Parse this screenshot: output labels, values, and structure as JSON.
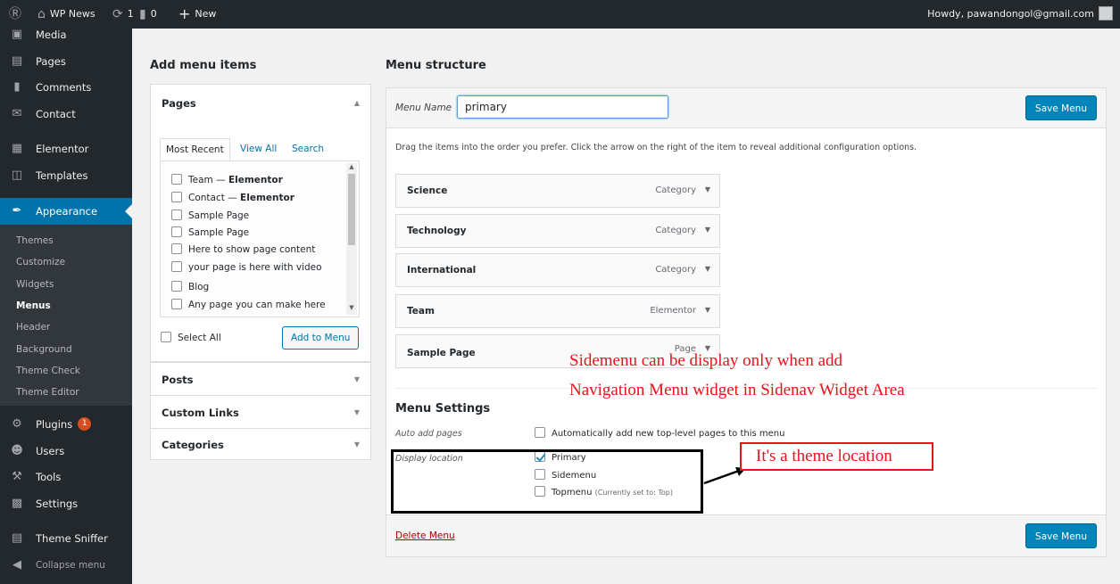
{
  "adminbar": {
    "site_name": "WP News",
    "updates": "1",
    "comments": "0",
    "new_label": "New",
    "howdy": "Howdy, pawandongol@gmail.com"
  },
  "sidebar": {
    "items": [
      {
        "label": "Media",
        "icon": "media-icon"
      },
      {
        "label": "Pages",
        "icon": "pages-icon"
      },
      {
        "label": "Comments",
        "icon": "comments-icon"
      },
      {
        "label": "Contact",
        "icon": "contact-icon"
      },
      {
        "label": "Elementor",
        "icon": "elementor-icon"
      },
      {
        "label": "Templates",
        "icon": "templates-icon"
      },
      {
        "label": "Appearance",
        "icon": "appearance-icon"
      },
      {
        "label": "Plugins",
        "icon": "plugins-icon",
        "badge": "1"
      },
      {
        "label": "Users",
        "icon": "users-icon"
      },
      {
        "label": "Tools",
        "icon": "tools-icon"
      },
      {
        "label": "Settings",
        "icon": "settings-icon"
      },
      {
        "label": "Theme Sniffer",
        "icon": "theme-sniffer-icon"
      },
      {
        "label": "Collapse menu",
        "icon": "collapse-icon"
      }
    ],
    "submenu": [
      "Themes",
      "Customize",
      "Widgets",
      "Menus",
      "Header",
      "Background",
      "Theme Check",
      "Theme Editor"
    ],
    "current_submenu": "Menus"
  },
  "add_items": {
    "heading": "Add menu items",
    "pages_title": "Pages",
    "tabs": [
      "Most Recent",
      "View All",
      "Search"
    ],
    "pages": [
      {
        "label": "Team",
        "suffix": "Elementor"
      },
      {
        "label": "Contact",
        "suffix": "Elementor"
      },
      {
        "label": "Sample Page",
        "suffix": ""
      },
      {
        "label": "Sample Page",
        "suffix": ""
      },
      {
        "label": "Here to show page content",
        "suffix": ""
      },
      {
        "label": "your page is here with video",
        "suffix": ""
      },
      {
        "label": "Blog",
        "suffix": ""
      },
      {
        "label": "Any page you can make here",
        "suffix": ""
      }
    ],
    "select_all": "Select All",
    "add_button": "Add to Menu",
    "posts_title": "Posts",
    "custom_links_title": "Custom Links",
    "categories_title": "Categories"
  },
  "structure": {
    "heading": "Menu structure",
    "menu_name_label": "Menu Name",
    "menu_name_value": "primary",
    "save_label": "Save Menu",
    "drag_info": "Drag the items into the order you prefer. Click the arrow on the right of the item to reveal additional configuration options.",
    "items": [
      {
        "title": "Science",
        "type": "Category"
      },
      {
        "title": "Technology",
        "type": "Category"
      },
      {
        "title": "International",
        "type": "Category"
      },
      {
        "title": "Team",
        "type": "Elementor"
      },
      {
        "title": "Sample Page",
        "type": "Page"
      }
    ],
    "settings_title": "Menu Settings",
    "auto_add_label": "Auto add pages",
    "auto_add_option": "Automatically add new top-level pages to this menu",
    "display_location_label": "Display location",
    "locations": [
      {
        "label": "Primary",
        "checked": true,
        "note": ""
      },
      {
        "label": "Sidemenu",
        "checked": false,
        "note": ""
      },
      {
        "label": "Topmenu",
        "checked": false,
        "note": "(Currently set to: Top)"
      }
    ],
    "delete_label": "Delete Menu"
  },
  "annotations": {
    "line1": "Sidemenu can be display only when add",
    "line2": "Navigation Menu widget in Sidenav Widget Area",
    "theme_location": "It's a theme location",
    "color": "#e8131b"
  }
}
